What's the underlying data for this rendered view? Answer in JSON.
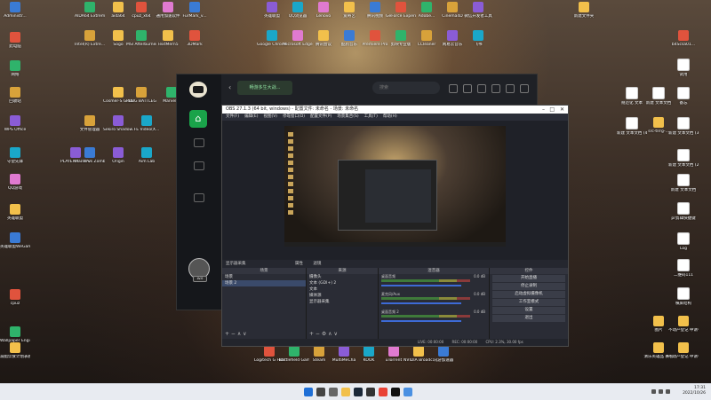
{
  "desktop": {
    "left_icons": [
      {
        "label": "Administr...",
        "icon": "user-folder-icon"
      },
      {
        "label": "此电脑",
        "icon": "computer-icon"
      },
      {
        "label": "网络",
        "icon": "network-icon"
      },
      {
        "label": "回收站",
        "icon": "recycle-bin-icon"
      },
      {
        "label": "WPS Office",
        "icon": "wps-icon"
      },
      {
        "label": "守望先锋",
        "icon": "overwatch-icon"
      },
      {
        "label": "QQ游戏",
        "icon": "qq-game-icon"
      },
      {
        "label": "英雄联盟",
        "icon": "lol-icon"
      },
      {
        "label": "英雄联盟WeGame版",
        "icon": "lol-wegame-icon"
      },
      {
        "label": "cpuz",
        "icon": "cpuz-icon"
      },
      {
        "label": "Wallpaper Engine: ...",
        "icon": "wallpaper-engine-icon"
      },
      {
        "label": "减脂饮食计划表教程",
        "icon": "folder-icon"
      }
    ],
    "col2_icons": [
      {
        "label": "AIDA64 Extreme",
        "icon": "aida64-icon"
      },
      {
        "label": "Intel(R) Extre...",
        "icon": "intel-icon"
      },
      {
        "label": "PLAYERU... BATTLEGR...",
        "icon": "pubg-icon"
      },
      {
        "label": "aida64",
        "icon": "folder-icon"
      },
      {
        "label": "Sogo",
        "icon": "folder-icon"
      },
      {
        "label": "Cosmer-S Global Off...",
        "icon": "game-icon"
      },
      {
        "label": "Plants vs Zombies...",
        "icon": "pvz-icon"
      },
      {
        "label": "cpuz_x64",
        "icon": "cpuz-icon"
      },
      {
        "label": "MSI Afterburner",
        "icon": "msi-icon"
      },
      {
        "label": "PUBG BATTLEGR...",
        "icon": "pubg-icon"
      },
      {
        "label": "Origin",
        "icon": "origin-icon"
      },
      {
        "label": "Aim Lab",
        "icon": "aimlab-icon"
      },
      {
        "label": "通用加速软件",
        "icon": "app-icon"
      },
      {
        "label": "TextMern5",
        "icon": "app-icon"
      },
      {
        "label": "FurMark_v...",
        "icon": "furmark-icon"
      },
      {
        "label": "3DMark",
        "icon": "3dmark-icon"
      },
      {
        "label": "Marvel...",
        "icon": "marvel-icon"
      },
      {
        "label": "文件管理器",
        "icon": "file-icon"
      },
      {
        "label": "Sekiro Shadow...",
        "icon": "sekiro-icon"
      },
      {
        "label": "FE Video(X...",
        "icon": "app-icon"
      }
    ],
    "top_icons": [
      {
        "label": "英雄联盟",
        "icon": "lol-icon"
      },
      {
        "label": "QQ浏览器",
        "icon": "browser-icon"
      },
      {
        "label": "Lenovo",
        "icon": "app-icon"
      },
      {
        "label": "爱奇艺",
        "icon": "iqiyi-icon"
      },
      {
        "label": "腾讯视频",
        "icon": "video-icon"
      },
      {
        "label": "GeForce Experience",
        "icon": "nvidia-icon"
      },
      {
        "label": "Adobe...",
        "icon": "adobe-icon"
      },
      {
        "label": "Cinema4D",
        "icon": "c4d-icon"
      },
      {
        "label": "微信开发者工具",
        "icon": "wechat-dev-icon"
      },
      {
        "label": "Google Chrome",
        "icon": "chrome-icon"
      },
      {
        "label": "Microsoft Edge",
        "icon": "edge-icon"
      },
      {
        "label": "腾讯会议",
        "icon": "meeting-icon"
      },
      {
        "label": "酷狗音乐",
        "icon": "kugou-icon"
      },
      {
        "label": "Premiere Pro",
        "icon": "premiere-icon"
      },
      {
        "label": "剪映专业版",
        "icon": "capcut-icon"
      },
      {
        "label": "CCleaner",
        "icon": "ccleaner-icon"
      },
      {
        "label": "网易云音乐",
        "icon": "netease-music-icon"
      },
      {
        "label": "飞书",
        "icon": "lark-icon"
      }
    ],
    "right_icons": [
      {
        "label": "新建文件夹",
        "icon": "folder-icon"
      },
      {
        "label": "b4Scsa01...",
        "icon": "file-icon"
      },
      {
        "label": "试用",
        "icon": "doc-icon"
      },
      {
        "label": "规范化 文本",
        "icon": "doc-icon"
      },
      {
        "label": "新建 文本文档",
        "icon": "doc-icon"
      },
      {
        "label": "备忘",
        "icon": "doc-icon"
      },
      {
        "label": "新建 文本文档 (4)",
        "icon": "doc-icon"
      },
      {
        "label": "src-tlrrg-...",
        "icon": "file-icon"
      },
      {
        "label": "新建 文本文档 (3)",
        "icon": "doc-icon"
      },
      {
        "label": "新建 文本文档 (2)",
        "icon": "doc-icon"
      },
      {
        "label": "新建 文本文档",
        "icon": "doc-icon"
      },
      {
        "label": "pr剪辑快捷键",
        "icon": "doc-icon"
      },
      {
        "label": "Log",
        "icon": "doc-icon"
      },
      {
        "label": "二维码111",
        "icon": "doc-icon"
      },
      {
        "label": "横屏结构",
        "icon": "doc-icon"
      },
      {
        "label": "图片",
        "icon": "folder-icon"
      },
      {
        "label": "不动产登记 申请书",
        "icon": "folder-icon"
      },
      {
        "label": "清乐英雄品 赛程",
        "icon": "folder-icon"
      },
      {
        "label": "不动产登记 申请书",
        "icon": "folder-icon"
      }
    ],
    "bottom_center_icons": [
      {
        "label": "Logitech G HUB",
        "icon": "logitech-icon"
      },
      {
        "label": "Battlefield Games L...",
        "icon": "battlefield-icon"
      },
      {
        "label": "Steam",
        "icon": "steam-icon"
      },
      {
        "label": "MultiMeCha",
        "icon": "app-icon"
      },
      {
        "label": "KOOK",
        "icon": "kook-icon"
      },
      {
        "label": "uTorrent",
        "icon": "utorrent-icon"
      },
      {
        "label": "NVIDIA Broadcast",
        "icon": "nvidia-icon"
      },
      {
        "label": "讯游加速器",
        "icon": "accelerator-icon"
      }
    ]
  },
  "booster": {
    "promo_label": "畅游多生大战...",
    "search_placeholder": "搜索",
    "badge": "LV.0"
  },
  "obs": {
    "title": "OBS 27.1.3 (64 bit, windows) - 配置文件: 未命名 - 场景: 未命名",
    "menu": [
      "文件(F)",
      "编辑(E)",
      "视图(V)",
      "停靠窗口(D)",
      "配置文件(P)",
      "场景集合(S)",
      "工具(T)",
      "帮助(H)"
    ],
    "scene_bar": {
      "source": "显示器采集",
      "props": "属性",
      "filter": "滤镜"
    },
    "docks": {
      "scenes": {
        "title": "场景",
        "items": [
          "场景",
          "场景 2"
        ]
      },
      "sources": {
        "title": "来源",
        "items": [
          "摄像头",
          "文本 (GDI+) 2",
          "文本",
          "媒体源",
          "显示器采集"
        ]
      },
      "mixer": {
        "title": "混音器",
        "channels": [
          {
            "name": "桌面音频",
            "db": "0.0 dB"
          },
          {
            "name": "麦克风/Aux",
            "db": "0.0 dB"
          },
          {
            "name": "桌面音频 2",
            "db": "0.0 dB"
          }
        ]
      },
      "controls": {
        "title": "控件",
        "buttons": [
          "开始直播",
          "停止录制",
          "启动虚拟摄像机",
          "工作室模式",
          "设置",
          "退出"
        ]
      }
    },
    "status": {
      "live": "LIVE: 00:00:00",
      "rec": "REC: 00:00:00",
      "cpu": "CPU: 2.3%, 30.00 fps"
    }
  },
  "taskbar": {
    "time": "17:31",
    "date": "2022/10/26",
    "apps": [
      "start-icon",
      "search-icon",
      "task-view-icon",
      "file-explorer-icon",
      "steam-icon",
      "obs-icon",
      "chrome-icon",
      "booster-icon",
      "app-icon"
    ]
  }
}
